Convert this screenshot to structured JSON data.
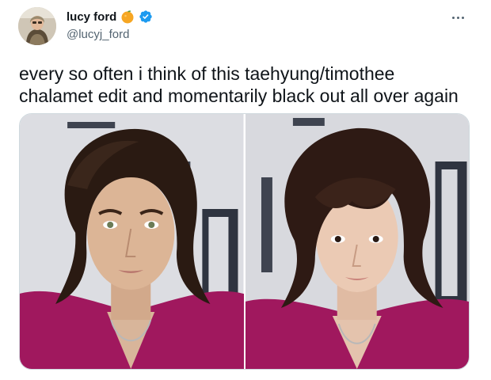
{
  "author": {
    "display_name": "lucy ford",
    "handle": "@lucyj_ford",
    "name_emoji": "orange-emoji",
    "verified_icon": "verified-badge-icon",
    "verified_color": "#1d9bf0"
  },
  "menu": {
    "icon": "more-options-icon"
  },
  "tweet": {
    "text": "every so often i think of this taehyung/timothee chalamet edit and momentarily black out all over again"
  },
  "media": {
    "photos": [
      {
        "icon": "portrait-photo-left"
      },
      {
        "icon": "portrait-photo-right"
      }
    ]
  },
  "colors": {
    "text_primary": "#0f1419",
    "text_secondary": "#536471",
    "suit": "#a0185e",
    "hair": "#2a1a12"
  }
}
